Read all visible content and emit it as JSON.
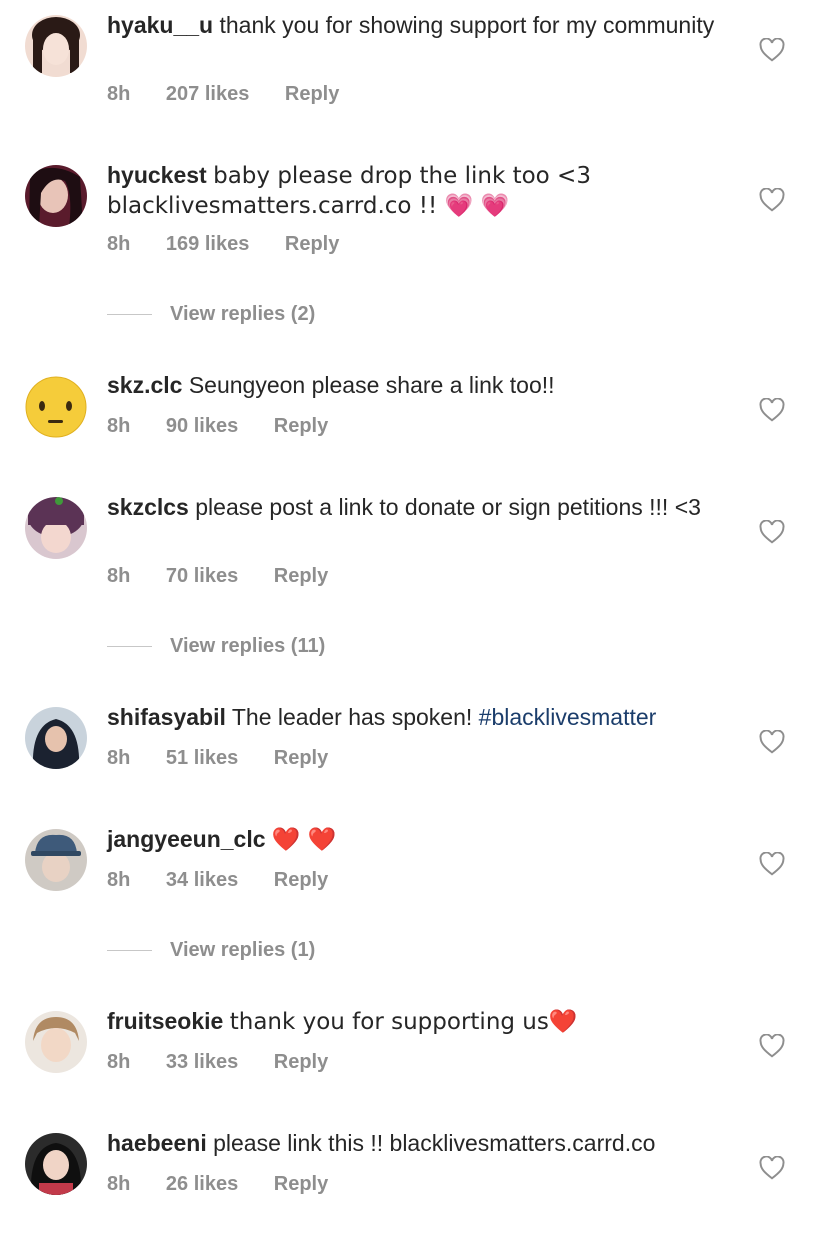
{
  "comments": [
    {
      "username": "hyaku__u",
      "text": "thank you for showing support for my community",
      "time": "8h",
      "likes": "207 likes",
      "reply": "Reply"
    },
    {
      "username": "hyuckest",
      "text": "baby please drop the link too <3 blacklivesmatters.carrd.co !! 💗 💗",
      "time": "8h",
      "likes": "169 likes",
      "reply": "Reply"
    },
    {
      "username": "skz.clc",
      "text": "Seungyeon please share a link too!!",
      "time": "8h",
      "likes": "90 likes",
      "reply": "Reply"
    },
    {
      "username": "skzclcs",
      "text": "please post a link to donate or sign petitions !!! <3",
      "time": "8h",
      "likes": "70 likes",
      "reply": "Reply"
    },
    {
      "username": "shifasyabil",
      "text": "The leader has spoken!",
      "hashtag": "#blacklivesmatter",
      "time": "8h",
      "likes": "51 likes",
      "reply": "Reply"
    },
    {
      "username": "jangyeeun_clc",
      "text": "❤️ ❤️",
      "time": "8h",
      "likes": "34 likes",
      "reply": "Reply"
    },
    {
      "username": "fruitseokie",
      "text": "thank you for supporting us❤️",
      "time": "8h",
      "likes": "33 likes",
      "reply": "Reply"
    },
    {
      "username": "haebeeni",
      "text": "please link this !! blacklivesmatters.carrd.co",
      "time": "8h",
      "likes": "26 likes",
      "reply": "Reply"
    }
  ],
  "view_replies": [
    {
      "label": "View replies (2)"
    },
    {
      "label": "View replies (11)"
    },
    {
      "label": "View replies (1)"
    }
  ],
  "icons": {
    "like": "heart-outline-icon"
  },
  "colors": {
    "text": "#262626",
    "meta": "#8e8e8e",
    "hashtag": "#1b3d6b"
  }
}
